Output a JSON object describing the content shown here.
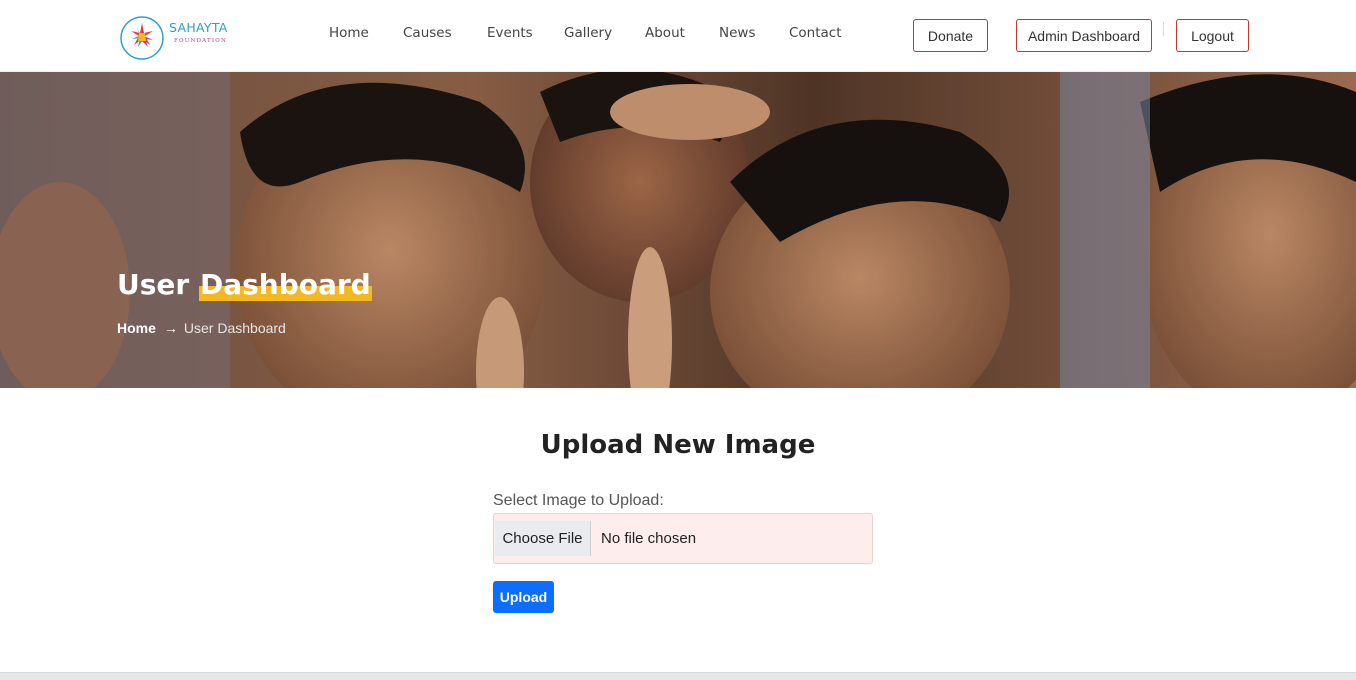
{
  "brand": {
    "name": "SAHAYTA",
    "tagline": "FOUNDATION",
    "colors": {
      "blue": "#2a9fd6",
      "magenta": "#c13a8e",
      "accent": "#f5b91f",
      "danger": "#c0392b",
      "primary": "#0d6efd"
    }
  },
  "nav": {
    "items": [
      "Home",
      "Causes",
      "Events",
      "Gallery",
      "About",
      "News",
      "Contact"
    ]
  },
  "actions": {
    "donate": "Donate",
    "admin": "Admin Dashboard",
    "logout": "Logout"
  },
  "hero": {
    "title_part1": "User ",
    "title_part2": "Dashboard",
    "breadcrumb_home": "Home",
    "breadcrumb_arrow": "→",
    "breadcrumb_current": "User Dashboard",
    "image": "children-smiling-photo"
  },
  "upload": {
    "heading": "Upload New Image",
    "label": "Select Image to Upload:",
    "choose_label": "Choose File",
    "file_status": "No file chosen",
    "submit_label": "Upload"
  }
}
